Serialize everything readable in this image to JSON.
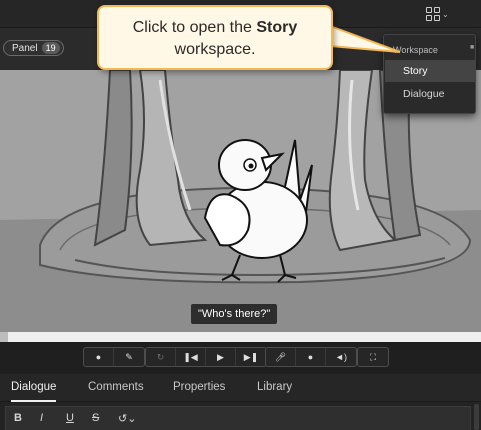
{
  "topbar": {
    "workspace_icon": "grid-icon",
    "caret_icon": "chevron-down-icon"
  },
  "panelbar": {
    "panel_label": "Panel",
    "panel_count": "19"
  },
  "canvas": {
    "subtitle": "\"Who's there?\""
  },
  "transport": {
    "groups": [
      [
        "speech-bubble-icon",
        "pencil-icon"
      ],
      [
        "loop-icon",
        "skip-back-icon",
        "play-icon",
        "skip-forward-icon"
      ],
      [
        "microphone-icon",
        "record-icon",
        "volume-icon"
      ],
      [
        "fullscreen-icon"
      ]
    ]
  },
  "tabs": [
    "Dialogue",
    "Comments",
    "Properties",
    "Library"
  ],
  "format": {
    "bold": "B",
    "italic": "I",
    "underline": "U",
    "strike": "S",
    "history_icon": "history-icon"
  },
  "workspace_menu": {
    "header": "Workspace",
    "items": [
      "Story",
      "Dialogue"
    ],
    "selected": "Story"
  },
  "callout": {
    "text_before": "Click to open the ",
    "text_bold": "Story",
    "text_after": "workspace.",
    "color": "#f3b754"
  }
}
